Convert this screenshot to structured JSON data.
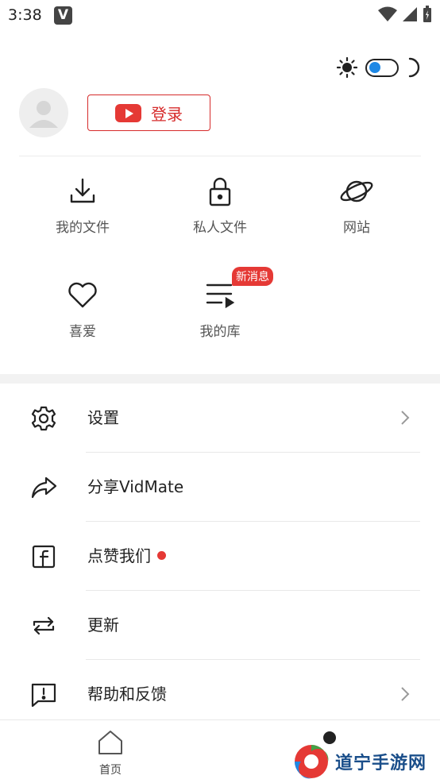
{
  "status_bar": {
    "time": "3:38",
    "app_icon_letter": "V"
  },
  "header": {
    "login_label": "登录"
  },
  "quick_grid": [
    {
      "label": "我的文件",
      "icon": "download-icon"
    },
    {
      "label": "私人文件",
      "icon": "lock-icon"
    },
    {
      "label": "网站",
      "icon": "planet-icon"
    },
    {
      "label": "喜爱",
      "icon": "heart-icon"
    },
    {
      "label": "我的库",
      "icon": "playlist-icon",
      "badge": "新消息"
    }
  ],
  "menu": [
    {
      "label": "设置",
      "icon": "gear-icon",
      "chevron": true
    },
    {
      "label": "分享VidMate",
      "icon": "share-icon",
      "chevron": false
    },
    {
      "label": "点赞我们",
      "icon": "facebook-icon",
      "chevron": false,
      "dot": true
    },
    {
      "label": "更新",
      "icon": "update-icon",
      "chevron": false
    },
    {
      "label": "帮助和反馈",
      "icon": "feedback-icon",
      "chevron": true
    }
  ],
  "bottom_nav": {
    "home_label": "首页",
    "watermark": "道宁手游网"
  },
  "colors": {
    "accent_red": "#e53935",
    "toggle_blue": "#1e88e5"
  }
}
